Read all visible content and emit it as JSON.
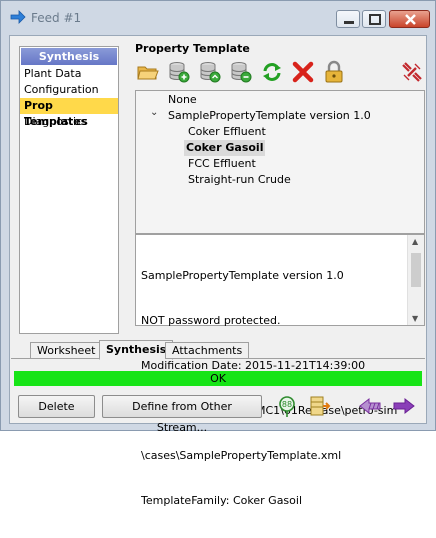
{
  "window": {
    "title": "Feed #1"
  },
  "nav": {
    "header": "Synthesis",
    "items": [
      {
        "label": "Plant Data",
        "selected": false
      },
      {
        "label": "Configuration",
        "selected": false
      },
      {
        "label": "Prop Templates",
        "selected": true
      },
      {
        "label": "Diagnostics",
        "selected": false
      }
    ]
  },
  "property_template": {
    "label": "Property Template",
    "toolbar": [
      "open-folder-icon",
      "database-add-icon",
      "database-copy-icon",
      "database-remove-icon",
      "refresh-icon",
      "delete-icon",
      "lock-icon",
      "disconnect-icon"
    ],
    "tree": {
      "none_label": "None",
      "root_label": "SamplePropertyTemplate version 1.0",
      "children": [
        "Coker Effluent",
        "Coker Gasoil",
        "FCC Effluent",
        "Straight-run Crude"
      ],
      "selected": "Coker Gasoil"
    },
    "info_lines": [
      "SamplePropertyTemplate version 1.0",
      "NOT password protected.",
      "Modification Date: 2015-11-21T14:39:00",
      "Source: C:\\P4Clients\\MC1\\61Release\\petro-sim",
      "\\cases\\SamplePropertyTemplate.xml",
      "TemplateFamily: Coker Gasoil"
    ]
  },
  "tabs": [
    {
      "label": "Worksheet",
      "active": false
    },
    {
      "label": "Synthesis",
      "active": true
    },
    {
      "label": "Attachments",
      "active": false
    }
  ],
  "status": {
    "text": "OK",
    "color": "#17e417"
  },
  "buttons": {
    "delete": "Delete",
    "define_from_other": "Define from Other Stream..."
  },
  "footer_icons": [
    "stream-link-icon",
    "ignore-icon",
    "previous-arrow-icon",
    "next-arrow-icon"
  ],
  "colors": {
    "nav_header": "#7080cc",
    "selection": "#ffd94a",
    "arrow": "#7a2fa0"
  }
}
